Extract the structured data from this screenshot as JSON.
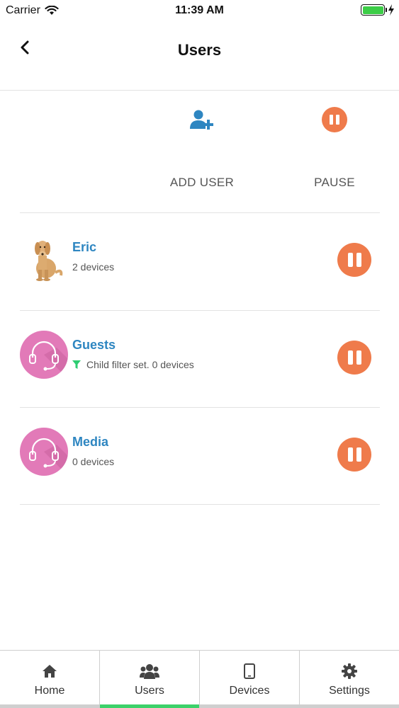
{
  "status_bar": {
    "carrier": "Carrier",
    "time": "11:39 AM"
  },
  "header": {
    "title": "Users"
  },
  "actions": {
    "add_user_label": "ADD USER",
    "pause_label": "PAUSE"
  },
  "users": [
    {
      "name": "Eric",
      "subtitle": "2 devices",
      "avatar": "dog-photo"
    },
    {
      "name": "Guests",
      "subtitle": "Child filter set. 0 devices",
      "avatar": "headset-icon",
      "filter_icon": "filter-icon"
    },
    {
      "name": "Media",
      "subtitle": "0 devices",
      "avatar": "headset-icon"
    }
  ],
  "tabs": [
    {
      "label": "Home",
      "icon": "home-icon",
      "active": false
    },
    {
      "label": "Users",
      "icon": "users-icon",
      "active": true
    },
    {
      "label": "Devices",
      "icon": "tablet-icon",
      "active": false
    },
    {
      "label": "Settings",
      "icon": "gear-icon",
      "active": false
    }
  ],
  "colors": {
    "accent_blue": "#2e86c1",
    "pause_orange": "#ef7b4b",
    "avatar_pink": "#e27ab8",
    "active_tab_green": "#3cd16a",
    "filter_green": "#2ecc71"
  }
}
